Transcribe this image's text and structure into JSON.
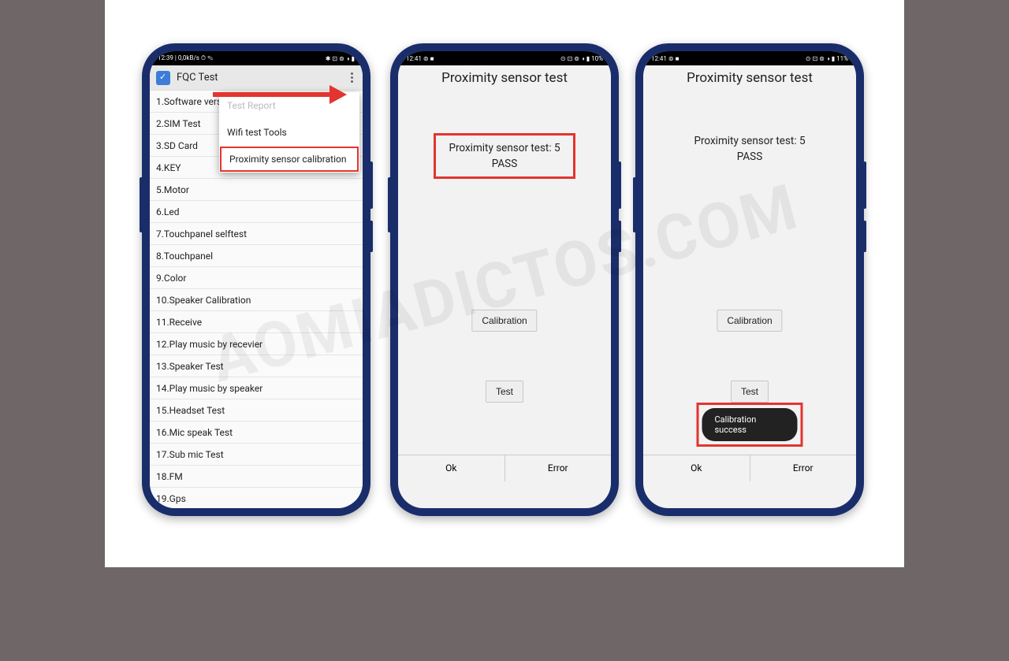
{
  "watermark": "AOMIADICTOS.COM",
  "phone1": {
    "status_left": "12:39 | 0,0kB/s ⏱ ✎",
    "status_right": "✱ ⊡ ⊚ ◑ ▮",
    "title": "FQC Test",
    "menu": {
      "item0": "Test Report",
      "item1": "Wifi test Tools",
      "item2": "Proximity sensor calibration"
    },
    "list": {
      "i1": "1.Software version",
      "i2": "2.SIM Test",
      "i3": "3.SD Card",
      "i4": "4.KEY",
      "i5": "5.Motor",
      "i6": "6.Led",
      "i7": "7.Touchpanel selftest",
      "i8": "8.Touchpanel",
      "i9": "9.Color",
      "i10": "10.Speaker Calibration",
      "i11": "11.Receive",
      "i12": "12.Play music by recevier",
      "i13": "13.Speaker Test",
      "i14": "14.Play music by speaker",
      "i15": "15.Headset Test",
      "i16": "16.Mic speak Test",
      "i17": "17.Sub mic Test",
      "i18": "18.FM",
      "i19": "19.Gps"
    }
  },
  "phone2": {
    "status_left": "12:41 ⊚ ■",
    "status_right": "⊙ ⊡ ⊚ ◑ ▮ 10%",
    "title": "Proximity sensor test",
    "result_line1": "Proximity sensor test: 5",
    "result_line2": "PASS",
    "btn_cal": "Calibration",
    "btn_test": "Test",
    "btn_ok": "Ok",
    "btn_err": "Error"
  },
  "phone3": {
    "status_left": "12:41 ⊚ ■",
    "status_right": "⊙ ⊡ ⊚ ◑ ▮ 11%",
    "title": "Proximity sensor test",
    "result_line1": "Proximity sensor test: 5",
    "result_line2": "PASS",
    "btn_cal": "Calibration",
    "btn_test": "Test",
    "toast": "Calibration success",
    "btn_ok": "Ok",
    "btn_err": "Error"
  }
}
